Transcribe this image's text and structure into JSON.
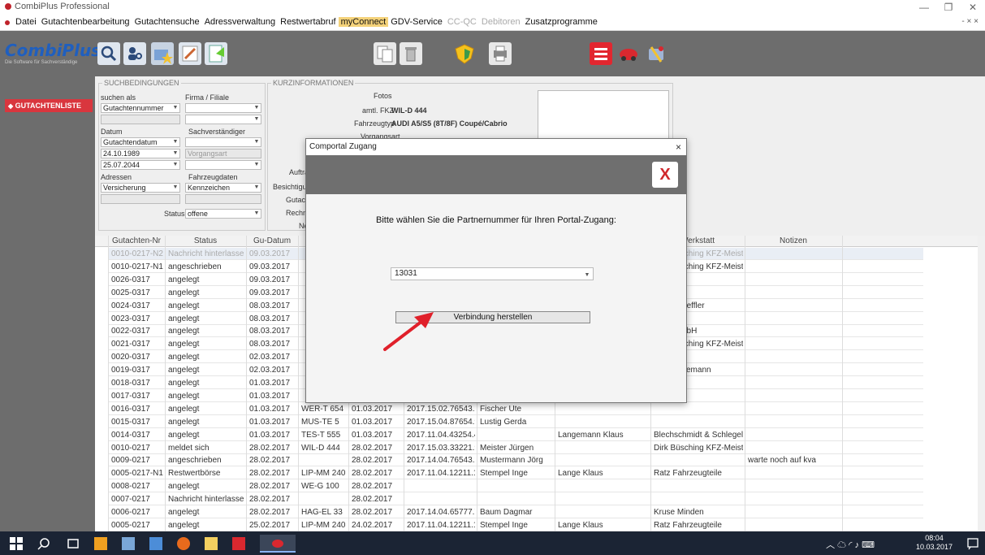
{
  "window": {
    "title": "CombiPlus Professional"
  },
  "menu": {
    "items": [
      {
        "label": "Datei",
        "state": "normal"
      },
      {
        "label": "Gutachtenbearbeitung",
        "state": "normal"
      },
      {
        "label": "Gutachtensuche",
        "state": "normal"
      },
      {
        "label": "Adressverwaltung",
        "state": "normal"
      },
      {
        "label": "Restwertabruf",
        "state": "normal"
      },
      {
        "label": "myConnect",
        "state": "highlight"
      },
      {
        "label": "GDV-Service",
        "state": "normal"
      },
      {
        "label": "CC-QC",
        "state": "disabled"
      },
      {
        "label": "Debitoren",
        "state": "disabled"
      },
      {
        "label": "Zusatzprogramme",
        "state": "normal"
      }
    ],
    "mdi_controls": "- × ×"
  },
  "logo": {
    "name": "CombiPlus",
    "tagline": "Die Software für Sachverständige"
  },
  "sidebar": {
    "nav_item": "GUTACHTENLISTE"
  },
  "search": {
    "legend": "SUCHBEDINGUNGEN",
    "search_as_label": "suchen als",
    "search_as_value": "Gutachtennummer",
    "firm_label": "Firma / Filiale",
    "date_label": "Datum",
    "expert_label": "Sachverständiger",
    "date_type_value": "Gutachtendatum",
    "date_from": "24.10.1989",
    "date_to": "25.07.2044",
    "process_type_placeholder": "Vorgangsart",
    "addresses_label": "Adressen",
    "vehicle_data_label": "Fahrzeugdaten",
    "address_value": "Versicherung",
    "vehicle_value": "Kennzeichen",
    "status_label": "Status",
    "status_value": "offene"
  },
  "info": {
    "legend": "KURZINFORMATIONEN",
    "photos_label": "Fotos",
    "fkz_label": "amtl. FKZ",
    "fkz_value": "WIL-D 444",
    "vehicle_type_label": "Fahrzeugtyp",
    "vehicle_type_value": "AUDI A5/S5 (8T/8F) Coupé/Cabrio",
    "process_type_label": "Vorgangsart",
    "partial_labels": [
      "Auftra",
      "Besichtigun",
      "Gutachte",
      "Rechnun",
      "Ne"
    ]
  },
  "grid": {
    "columns": [
      "Gutachten-Nr",
      "Status",
      "Gu-Datum",
      "",
      "",
      "",
      "",
      "er",
      "Werkstatt",
      "Notizen"
    ],
    "rows": [
      [
        "0010-0217-N2",
        "Nachricht hinterlassen",
        "09.03.2017",
        "",
        "",
        "",
        "",
        "",
        "Dirk Büsching KFZ-Meister",
        ""
      ],
      [
        "0010-0217-N1",
        "angeschrieben",
        "09.03.2017",
        "",
        "",
        "",
        "",
        "",
        "Dirk Büsching KFZ-Meister",
        ""
      ],
      [
        "0026-0317",
        "angelegt",
        "09.03.2017",
        "",
        "",
        "",
        "",
        "",
        "",
        ""
      ],
      [
        "0025-0317",
        "angelegt",
        "09.03.2017",
        "",
        "",
        "",
        "",
        "",
        "",
        ""
      ],
      [
        "0024-0317",
        "angelegt",
        "08.03.2017",
        "",
        "",
        "",
        "",
        "",
        "Auto Scheffler",
        ""
      ],
      [
        "0023-0317",
        "angelegt",
        "08.03.2017",
        "",
        "",
        "",
        "",
        "",
        "",
        ""
      ],
      [
        "0022-0317",
        "angelegt",
        "08.03.2017",
        "",
        "",
        "",
        "",
        "ud",
        "Elies GmbH",
        ""
      ],
      [
        "0021-0317",
        "angelegt",
        "08.03.2017",
        "",
        "",
        "",
        "",
        "",
        "Dirk Büsching KFZ-Meister",
        ""
      ],
      [
        "0020-0317",
        "angelegt",
        "02.03.2017",
        "",
        "",
        "",
        "",
        "r",
        "",
        ""
      ],
      [
        "0019-0317",
        "angelegt",
        "02.03.2017",
        "",
        "",
        "",
        "",
        "",
        "Willy Ackemann",
        ""
      ],
      [
        "0018-0317",
        "angelegt",
        "01.03.2017",
        "",
        "",
        "",
        "",
        "",
        "",
        ""
      ],
      [
        "0017-0317",
        "angelegt",
        "01.03.2017",
        "",
        "",
        "",
        "",
        "",
        "",
        ""
      ],
      [
        "0016-0317",
        "angelegt",
        "01.03.2017",
        "WER-T 654",
        "01.03.2017",
        "2017.15.02.76543.2 V",
        "Fischer Ute",
        "",
        "",
        ""
      ],
      [
        "0015-0317",
        "angelegt",
        "01.03.2017",
        "MUS-TE 5",
        "01.03.2017",
        "2017.15.04.87654.9 G",
        "Lustig Gerda",
        "",
        "",
        ""
      ],
      [
        "0014-0317",
        "angelegt",
        "01.03.2017",
        "TES-T 555",
        "01.03.2017",
        "2017.11.04.43254.4 G",
        "",
        "Langemann Klaus",
        "Blechschmidt & Schlegel ...",
        ""
      ],
      [
        "0010-0217",
        "meldet sich",
        "28.02.2017",
        "WIL-D 444",
        "28.02.2017",
        "2017.15.03.33221.9 G",
        "Meister Jürgen",
        "",
        "Dirk Büsching KFZ-Meister",
        ""
      ],
      [
        "0009-0217",
        "angeschrieben",
        "28.02.2017",
        "",
        "28.02.2017",
        "2017.14.04.76543.2 G",
        "Mustermann Jörg",
        "",
        "",
        "warte noch auf kva"
      ],
      [
        "0005-0217-N1",
        "Restwertbörse",
        "28.02.2017",
        "LIP-MM 240",
        "28.02.2017",
        "2017.11.04.12211.1 V",
        "Stempel Inge",
        "Lange Klaus",
        "Ratz Fahrzeugteile",
        ""
      ],
      [
        "0008-0217",
        "angelegt",
        "28.02.2017",
        "WE-G 100",
        "28.02.2017",
        "",
        "",
        "",
        "",
        ""
      ],
      [
        "0007-0217",
        "Nachricht hinterlassen",
        "28.02.2017",
        "",
        "28.02.2017",
        "",
        "",
        "",
        "",
        ""
      ],
      [
        "0006-0217",
        "angelegt",
        "28.02.2017",
        "HAG-EL 33",
        "28.02.2017",
        "2017.14.04.65777.7 G",
        "Baum Dagmar",
        "",
        "Kruse Minden",
        ""
      ],
      [
        "0005-0217",
        "angelegt",
        "25.02.2017",
        "LIP-MM 240",
        "24.02.2017",
        "2017.11.04.12211.1 V",
        "Stempel Inge",
        "Lange Klaus",
        "Ratz Fahrzeugteile",
        ""
      ]
    ]
  },
  "dialog": {
    "title": "Comportal Zugang",
    "close_glyph": "×",
    "header_close_glyph": "X",
    "prompt": "Bitte wählen Sie die Partnernummer für Ihren Portal-Zugang:",
    "partner_number": "13031",
    "connect_label": "Verbindung herstellen"
  },
  "taskbar": {
    "time": "08:04",
    "date": "10.03.2017"
  },
  "colors": {
    "accent_red": "#d9363e",
    "toolbar_gray": "#6d6d6d",
    "menu_highlight": "#f4d27a",
    "logo_blue": "#1f5fbf"
  },
  "icons": [
    "search-icon",
    "user-search-icon",
    "star-folder-icon",
    "edit-icon",
    "document-icon",
    "copy-icon",
    "trash-icon",
    "shield-icon",
    "print-icon",
    "list-icon",
    "car-icon",
    "tools-icon"
  ]
}
